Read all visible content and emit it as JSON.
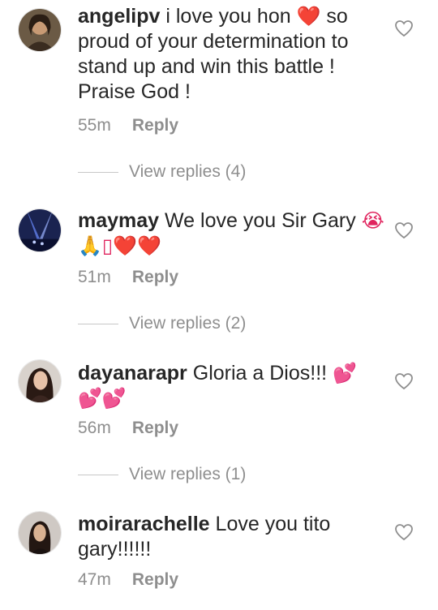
{
  "comments": [
    {
      "username": "angelipv",
      "text_a": "i love you hon ",
      "emoji_a": "❤️",
      "text_b": " so proud of your determination to stand up and win this battle ! Praise God !",
      "time": "55m",
      "reply_label": "Reply",
      "view_replies": "View replies (4)"
    },
    {
      "username": "maymay",
      "text_a": "We love you Sir Gary ",
      "emoji_a": "😭🙏▯❤️❤️",
      "text_b": "",
      "time": "51m",
      "reply_label": "Reply",
      "view_replies": "View replies (2)"
    },
    {
      "username": "dayanarapr",
      "text_a": "Gloria a Dios!!! ",
      "emoji_a": "💕 💕💕",
      "text_b": "",
      "time": "56m",
      "reply_label": "Reply",
      "view_replies": "View replies (1)"
    },
    {
      "username": "moirarachelle",
      "text_a": "Love you tito gary!!!!!!",
      "emoji_a": "",
      "text_b": "",
      "time": "47m",
      "reply_label": "Reply",
      "view_replies": ""
    }
  ],
  "colors": {
    "text": "#262626",
    "secondary": "#8e8e8e",
    "heart_emoji": "#e0245e",
    "pink_hearts": "#ff5fb0"
  }
}
